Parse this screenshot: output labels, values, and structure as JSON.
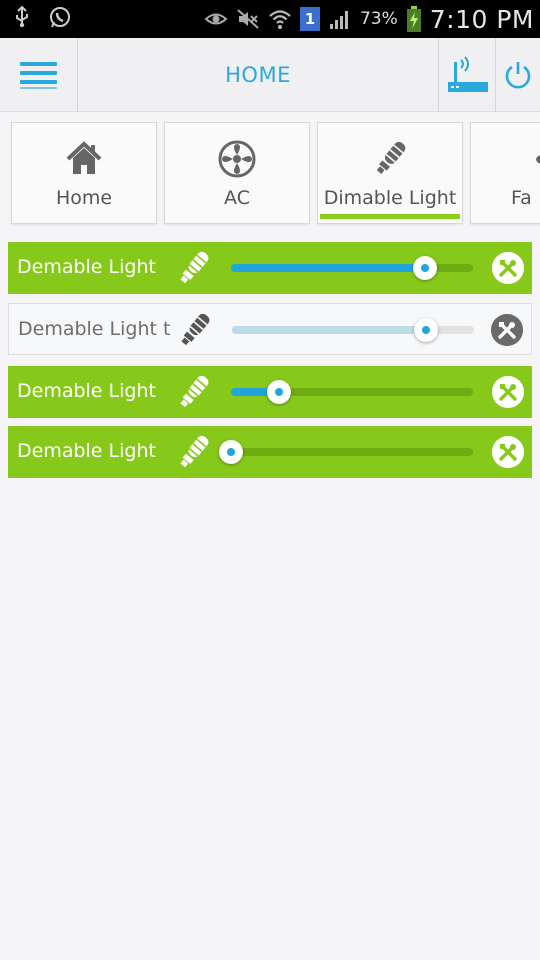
{
  "status_bar": {
    "battery": "73%",
    "time": "7:10 PM",
    "notification_badge": "1"
  },
  "header": {
    "title": "HOME"
  },
  "tabs": [
    {
      "label": "Home",
      "icon": "house-icon",
      "selected": false
    },
    {
      "label": "AC",
      "icon": "ac-fan-icon",
      "selected": false
    },
    {
      "label": "Dimable Light",
      "icon": "bulb-icon",
      "selected": true
    },
    {
      "label": "Fa",
      "icon": "fan-icon",
      "selected": false
    }
  ],
  "devices": [
    {
      "label": "Demable Light",
      "level": 0.8,
      "active": true
    },
    {
      "label": "Demable Light t",
      "level": 0.8,
      "active": false
    },
    {
      "label": "Demable Light",
      "level": 0.2,
      "active": true
    },
    {
      "label": "Demable Light",
      "level": 0.0,
      "active": true
    }
  ],
  "colors": {
    "accent_blue": "#2aa9df",
    "active_green": "#87c91b",
    "slider_blue": "#21a5dc"
  }
}
